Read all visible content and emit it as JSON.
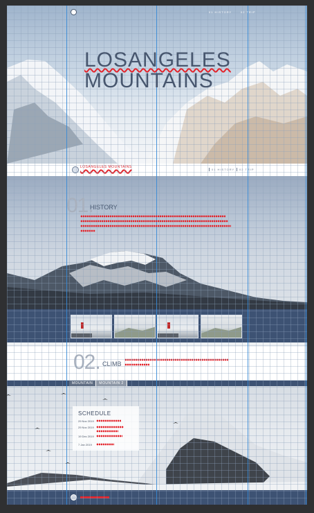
{
  "hero": {
    "title_line1": "LOSANGELES",
    "title_line2": "MOUNTAINS",
    "nav": [
      "01 HISTORY",
      "02 TRIP"
    ]
  },
  "navstrip": {
    "brand": "LOSANGELES MOUNTAINS",
    "links": [
      "01 HISTORY",
      "02 TRIP"
    ]
  },
  "history": {
    "number": "01.",
    "title": "HISTORY"
  },
  "climb": {
    "number": "02.",
    "title": "CLIMB",
    "tabs": [
      "MOUNTAIN",
      "MOUNTAIN 2"
    ]
  },
  "schedule": {
    "title": "SCHEDULE",
    "dates": [
      "29 Nov 2019",
      "29 Nov 2019",
      "19 Dec 2019",
      "7 Jan 2019"
    ]
  },
  "colors": {
    "accent": "#3d5273",
    "spell": "#e3242b",
    "guide": "#3689d6"
  },
  "icons": [
    "logo-icon",
    "bird-icon"
  ]
}
